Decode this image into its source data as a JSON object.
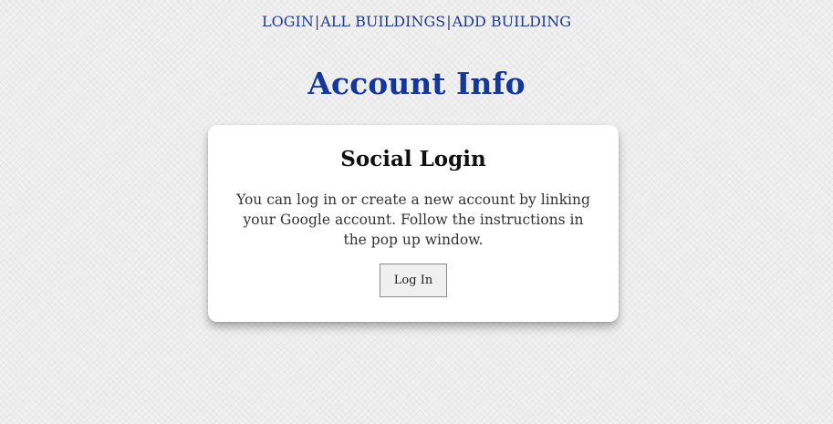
{
  "nav": {
    "items": [
      {
        "label": "LOGIN"
      },
      {
        "label": "ALL BUILDINGS"
      },
      {
        "label": "ADD BUILDING"
      }
    ],
    "separator": "|"
  },
  "page": {
    "title": "Account Info"
  },
  "card": {
    "title": "Social Login",
    "text": "You can log in or create a new account by linking your Google account. Follow the instructions in the pop up window.",
    "button_label": "Log In"
  },
  "colors": {
    "accent": "#14379b",
    "nav_link": "#1f3a93",
    "background": "#f1f1f1",
    "card": "#ffffff"
  }
}
